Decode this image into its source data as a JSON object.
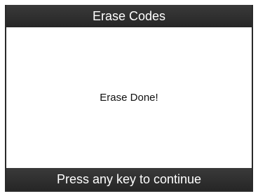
{
  "header": {
    "title": "Erase Codes"
  },
  "main": {
    "message": "Erase Done!"
  },
  "footer": {
    "prompt": "Press any key to continue"
  },
  "colors": {
    "bar_background": "#2a2a2a",
    "bar_text": "#ffffff",
    "content_background": "#ffffff",
    "content_text": "#111111"
  }
}
